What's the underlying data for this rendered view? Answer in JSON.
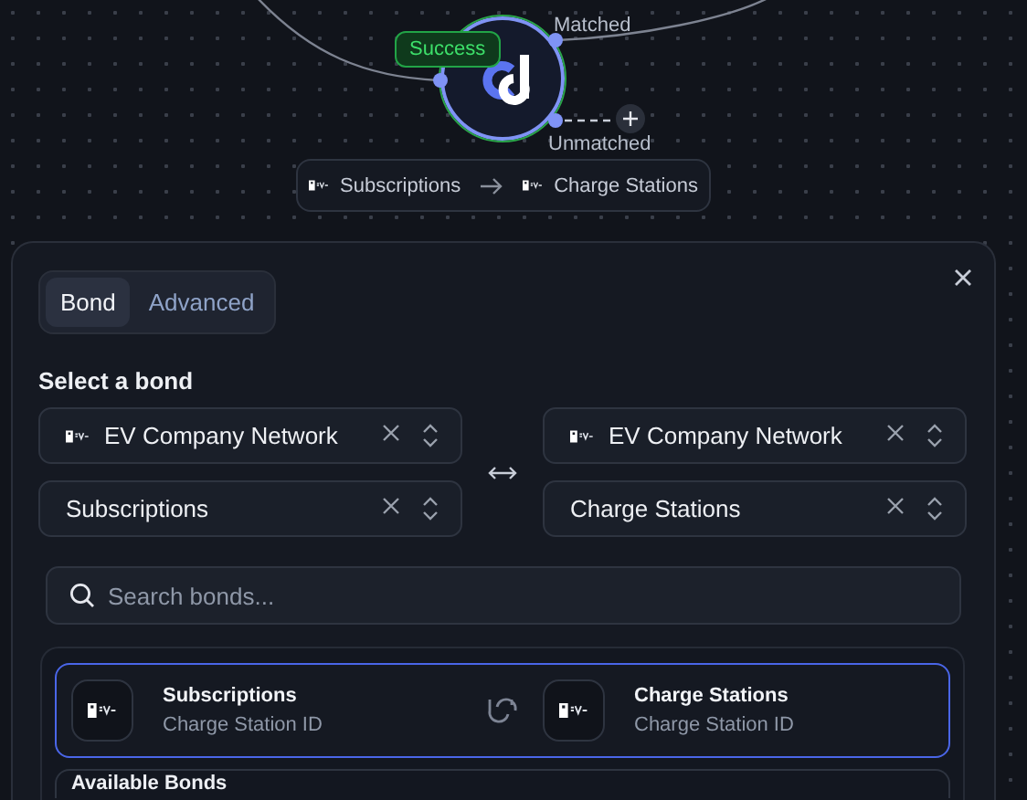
{
  "canvas": {
    "node": {
      "status": "Success",
      "outputs": [
        {
          "label": "Matched",
          "kind": "connected"
        },
        {
          "label": "Unmatched",
          "kind": "open"
        }
      ]
    },
    "route": {
      "source": "Subscriptions",
      "target": "Charge Stations"
    }
  },
  "panel": {
    "tabs": [
      {
        "label": "Bond",
        "selected": true
      },
      {
        "label": "Advanced",
        "selected": false
      }
    ],
    "heading": "Select a bond",
    "left": [
      {
        "value": "EV Company Network",
        "kind": "source"
      },
      {
        "value": "Subscriptions",
        "kind": "table"
      }
    ],
    "right": [
      {
        "value": "EV Company Network",
        "kind": "source"
      },
      {
        "value": "Charge Stations",
        "kind": "table"
      }
    ],
    "search": {
      "placeholder": "Search bonds..."
    },
    "bonds": [
      {
        "source": "Subscriptions",
        "source_field": "Charge Station ID",
        "target": "Charge Stations",
        "target_field": "Charge Station ID",
        "selected": true
      }
    ],
    "section": "Available Bonds"
  }
}
